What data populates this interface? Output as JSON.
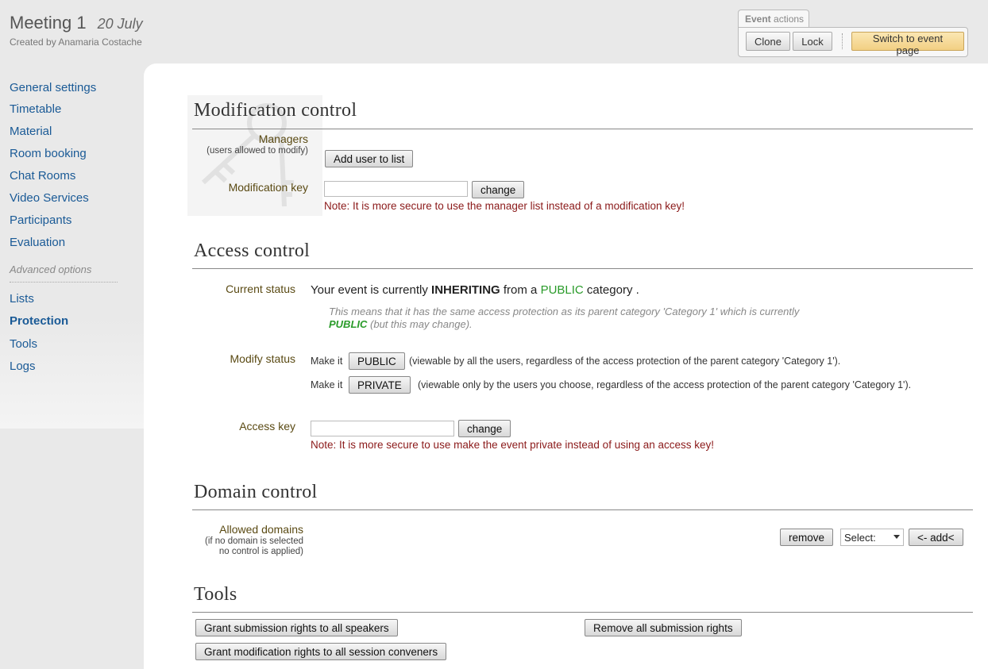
{
  "header": {
    "title": "Meeting 1",
    "date": "20 July",
    "created_by": "Created by Anamaria Costache"
  },
  "event_actions": {
    "tab_label_bold": "Event",
    "tab_label_rest": "actions",
    "clone": "Clone",
    "lock": "Lock",
    "switch": "Switch to event page"
  },
  "sidebar": {
    "items": [
      "General settings",
      "Timetable",
      "Material",
      "Room booking",
      "Chat Rooms",
      "Video Services",
      "Participants",
      "Evaluation"
    ],
    "advanced_label": "Advanced options",
    "advanced_items": [
      "Lists",
      "Protection",
      "Tools",
      "Logs"
    ],
    "active": "Protection"
  },
  "modification": {
    "title": "Modification control",
    "managers_label": "Managers",
    "managers_sub": "(users allowed to modify)",
    "add_user": "Add user to list",
    "key_label": "Modification key",
    "key_value": "",
    "change": "change",
    "note": "Note: It is more secure to use the manager list instead of a modification key!"
  },
  "access": {
    "title": "Access control",
    "current_status_label": "Current status",
    "status_pre": "Your event is currently",
    "status_mode": "INHERITING",
    "status_mid": "from a",
    "status_public": "PUBLIC",
    "status_post": "category .",
    "explain_pre": "This means that it has the same access protection as its parent category 'Category 1' which is currently",
    "explain_public": "PUBLIC",
    "explain_post": "(but this may change).",
    "modify_status_label": "Modify status",
    "make_it": "Make it",
    "public_btn": "PUBLIC",
    "public_desc": "(viewable by all the users, regardless of the access protection of the parent category 'Category 1').",
    "private_btn": "PRIVATE",
    "private_desc": "(viewable only by the users you choose, regardless of the access protection of the parent category 'Category 1').",
    "access_key_label": "Access key",
    "access_key_value": "",
    "change": "change",
    "note": "Note: It is more secure to use make the event private instead of using an access key!"
  },
  "domain": {
    "title": "Domain control",
    "allowed_label": "Allowed domains",
    "allowed_sub1": "(if no domain is selected",
    "allowed_sub2": "no control is applied)",
    "remove": "remove",
    "select_value": "Select:",
    "add": "<- add<"
  },
  "tools": {
    "title": "Tools",
    "grant_submission": "Grant submission rights to all speakers",
    "remove_submission": "Remove all submission rights",
    "grant_modification": "Grant modification rights to all session conveners"
  }
}
